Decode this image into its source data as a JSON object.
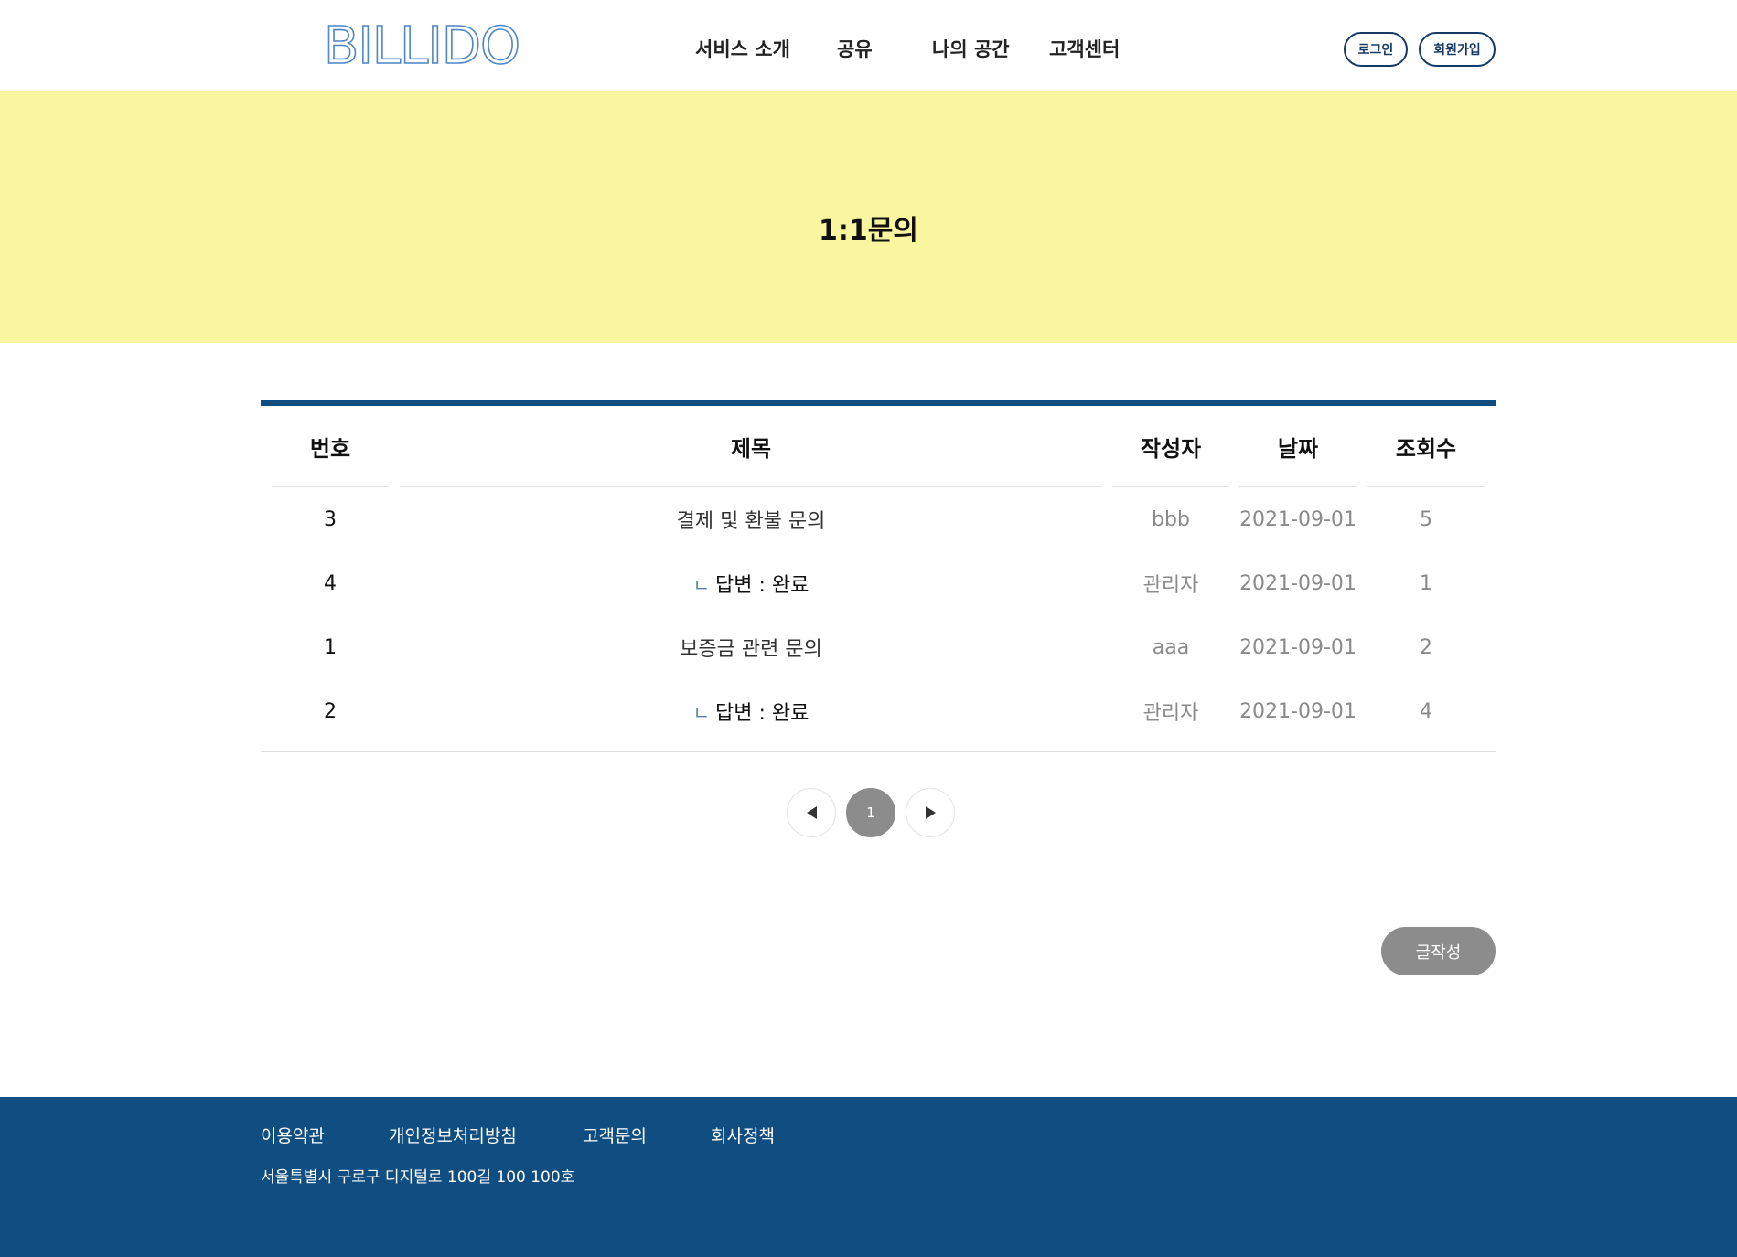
{
  "header": {
    "logo_text": "BILLIDO",
    "nav": [
      "서비스 소개",
      "공유",
      "나의 공간",
      "고객센터"
    ],
    "login_label": "로그인",
    "signup_label": "회원가입"
  },
  "banner": {
    "title": "1:1문의"
  },
  "board": {
    "columns": [
      "번호",
      "제목",
      "작성자",
      "날짜",
      "조회수"
    ],
    "reply_mark": "ㄴ",
    "rows": [
      {
        "no": "3",
        "title": "결제 및 환불 문의",
        "reply": false,
        "writer": "bbb",
        "date": "2021-09-01",
        "views": "5"
      },
      {
        "no": "4",
        "title": "답변 :  완료",
        "reply": true,
        "writer": "관리자",
        "date": "2021-09-01",
        "views": "1"
      },
      {
        "no": "1",
        "title": "보증금 관련 문의",
        "reply": false,
        "writer": "aaa",
        "date": "2021-09-01",
        "views": "2"
      },
      {
        "no": "2",
        "title": "답변 :  완료",
        "reply": true,
        "writer": "관리자",
        "date": "2021-09-01",
        "views": "4"
      }
    ]
  },
  "pagination": {
    "current": "1"
  },
  "write_button_label": "글작성",
  "footer": {
    "links": [
      "이용약관",
      "개인정보처리방침",
      "고객문의",
      "회사정책"
    ],
    "address": "서울특별시 구로구 디지털로 100길 100 100호"
  },
  "colors": {
    "navy": "#104e82",
    "banner_yellow": "#faf59f",
    "gray_button": "#8c8c8c",
    "logo_blue": "#4f86c6"
  }
}
